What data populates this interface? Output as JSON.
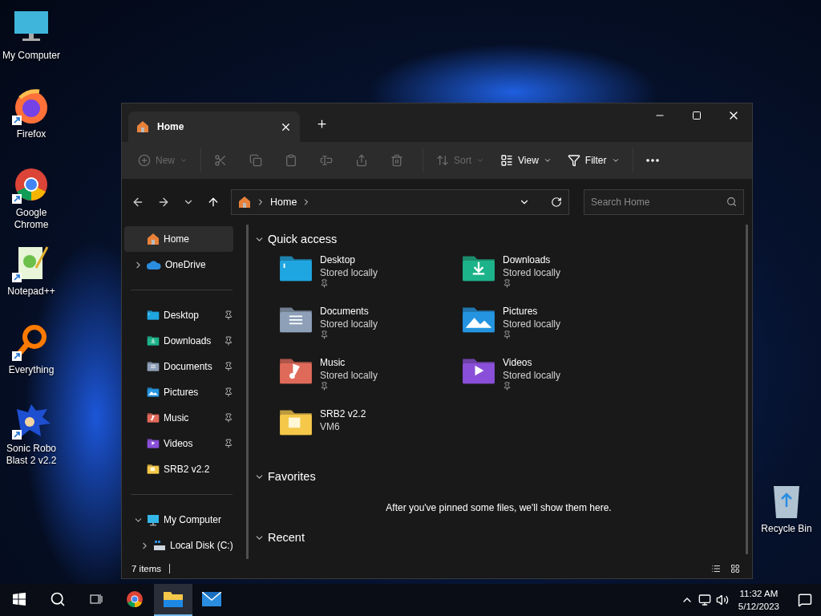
{
  "desktop_icons": [
    {
      "label": "My Computer",
      "kind": "computer",
      "shortcut": false
    },
    {
      "label": "Firefox",
      "kind": "firefox",
      "shortcut": true
    },
    {
      "label": "Google Chrome",
      "kind": "chrome",
      "shortcut": true
    },
    {
      "label": "Notepad++",
      "kind": "notepad",
      "shortcut": true
    },
    {
      "label": "Everything",
      "kind": "everything",
      "shortcut": true
    },
    {
      "label": "Sonic Robo Blast 2 v2.2",
      "kind": "sonic",
      "shortcut": true
    }
  ],
  "recycle_bin": {
    "label": "Recycle Bin"
  },
  "window": {
    "tabs": [
      {
        "label": "Home",
        "selected": true
      }
    ],
    "toolbar": [
      {
        "kind": "new",
        "label": "New",
        "disabled": true
      },
      {
        "kind": "cut",
        "disabled": true
      },
      {
        "kind": "copy",
        "disabled": true
      },
      {
        "kind": "paste",
        "disabled": true
      },
      {
        "kind": "rename",
        "disabled": true
      },
      {
        "kind": "share",
        "disabled": true
      },
      {
        "kind": "delete",
        "disabled": true
      },
      {
        "kind": "sort",
        "label": "Sort",
        "disabled": true
      },
      {
        "kind": "view",
        "label": "View",
        "disabled": false
      },
      {
        "kind": "filter",
        "label": "Filter",
        "disabled": false
      },
      {
        "kind": "more",
        "disabled": false
      }
    ],
    "address": {
      "path": "Home"
    },
    "search": {
      "placeholder": "Search Home"
    },
    "nav_pane": {
      "groups": [
        [
          {
            "label": "Home",
            "kind": "home",
            "selected": true
          },
          {
            "label": "OneDrive",
            "kind": "cloud",
            "selected": false,
            "expanded": false
          }
        ],
        [
          {
            "label": "Desktop",
            "kind": "desktop",
            "selected": false,
            "pinned": true
          },
          {
            "label": "Downloads",
            "kind": "downloads",
            "selected": false,
            "pinned": true
          },
          {
            "label": "Documents",
            "kind": "documents",
            "selected": false,
            "pinned": true
          },
          {
            "label": "Pictures",
            "kind": "pictures",
            "selected": false,
            "pinned": true
          },
          {
            "label": "Music",
            "kind": "music",
            "selected": false,
            "pinned": true
          },
          {
            "label": "Videos",
            "kind": "videos",
            "selected": false,
            "pinned": true
          },
          {
            "label": "SRB2 v2.2",
            "kind": "folder",
            "selected": false,
            "pinned": false
          }
        ],
        [
          {
            "label": "My Computer",
            "kind": "computer",
            "selected": false,
            "expanded": true,
            "children": [
              {
                "label": "Local Disk (C:)",
                "kind": "disk",
                "selected": false,
                "expanded": false
              }
            ]
          }
        ]
      ]
    },
    "sections": [
      {
        "title": "Quick access",
        "expanded": true,
        "items": [
          {
            "name": "Desktop",
            "detail": "Stored locally",
            "kind": "desktop",
            "pinned": true
          },
          {
            "name": "Downloads",
            "detail": "Stored locally",
            "kind": "downloads",
            "pinned": true
          },
          {
            "name": "Documents",
            "detail": "Stored locally",
            "kind": "documents",
            "pinned": true
          },
          {
            "name": "Pictures",
            "detail": "Stored locally",
            "kind": "pictures",
            "pinned": true
          },
          {
            "name": "Music",
            "detail": "Stored locally",
            "kind": "music",
            "pinned": true
          },
          {
            "name": "Videos",
            "detail": "Stored locally",
            "kind": "videos",
            "pinned": true
          },
          {
            "name": "SRB2 v2.2",
            "detail": "VM6",
            "kind": "folder",
            "pinned": false
          }
        ]
      },
      {
        "title": "Favorites",
        "expanded": true,
        "message": "After you've pinned some files, we'll show them here."
      },
      {
        "title": "Recent",
        "expanded": true
      }
    ],
    "status_bar": {
      "count": "7 items"
    }
  },
  "taskbar": {
    "apps": [
      {
        "kind": "start",
        "active": false
      },
      {
        "kind": "search",
        "active": false
      },
      {
        "kind": "taskview",
        "active": false
      },
      {
        "kind": "chrome",
        "active": false
      },
      {
        "kind": "explorer",
        "active": true
      },
      {
        "kind": "mail",
        "active": false
      }
    ],
    "clock": {
      "time": "11:32 AM",
      "date": "5/12/2023"
    }
  }
}
